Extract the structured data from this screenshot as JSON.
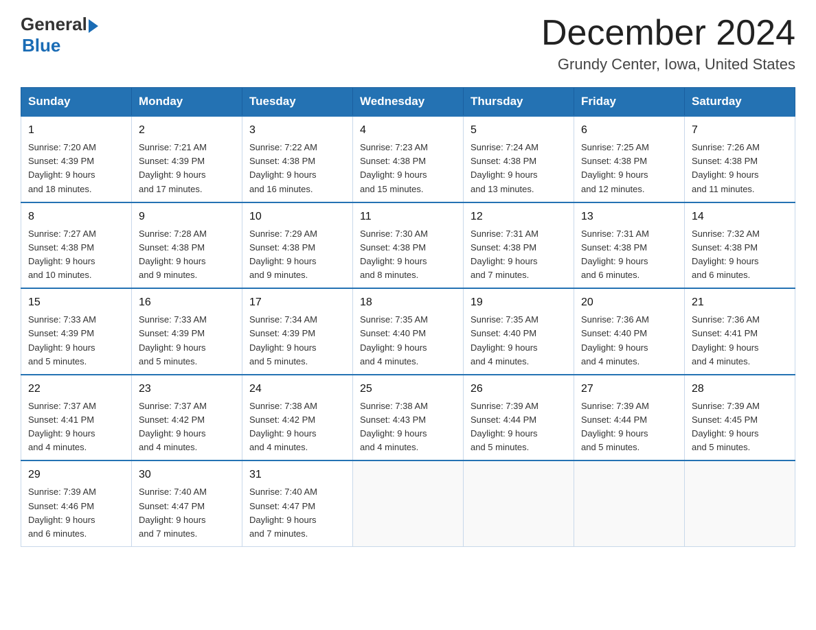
{
  "header": {
    "logo_general": "General",
    "logo_blue": "Blue",
    "month_title": "December 2024",
    "location": "Grundy Center, Iowa, United States"
  },
  "days_of_week": [
    "Sunday",
    "Monday",
    "Tuesday",
    "Wednesday",
    "Thursday",
    "Friday",
    "Saturday"
  ],
  "weeks": [
    [
      {
        "day": 1,
        "sunrise": "7:20 AM",
        "sunset": "4:39 PM",
        "daylight": "9 hours and 18 minutes."
      },
      {
        "day": 2,
        "sunrise": "7:21 AM",
        "sunset": "4:39 PM",
        "daylight": "9 hours and 17 minutes."
      },
      {
        "day": 3,
        "sunrise": "7:22 AM",
        "sunset": "4:38 PM",
        "daylight": "9 hours and 16 minutes."
      },
      {
        "day": 4,
        "sunrise": "7:23 AM",
        "sunset": "4:38 PM",
        "daylight": "9 hours and 15 minutes."
      },
      {
        "day": 5,
        "sunrise": "7:24 AM",
        "sunset": "4:38 PM",
        "daylight": "9 hours and 13 minutes."
      },
      {
        "day": 6,
        "sunrise": "7:25 AM",
        "sunset": "4:38 PM",
        "daylight": "9 hours and 12 minutes."
      },
      {
        "day": 7,
        "sunrise": "7:26 AM",
        "sunset": "4:38 PM",
        "daylight": "9 hours and 11 minutes."
      }
    ],
    [
      {
        "day": 8,
        "sunrise": "7:27 AM",
        "sunset": "4:38 PM",
        "daylight": "9 hours and 10 minutes."
      },
      {
        "day": 9,
        "sunrise": "7:28 AM",
        "sunset": "4:38 PM",
        "daylight": "9 hours and 9 minutes."
      },
      {
        "day": 10,
        "sunrise": "7:29 AM",
        "sunset": "4:38 PM",
        "daylight": "9 hours and 9 minutes."
      },
      {
        "day": 11,
        "sunrise": "7:30 AM",
        "sunset": "4:38 PM",
        "daylight": "9 hours and 8 minutes."
      },
      {
        "day": 12,
        "sunrise": "7:31 AM",
        "sunset": "4:38 PM",
        "daylight": "9 hours and 7 minutes."
      },
      {
        "day": 13,
        "sunrise": "7:31 AM",
        "sunset": "4:38 PM",
        "daylight": "9 hours and 6 minutes."
      },
      {
        "day": 14,
        "sunrise": "7:32 AM",
        "sunset": "4:38 PM",
        "daylight": "9 hours and 6 minutes."
      }
    ],
    [
      {
        "day": 15,
        "sunrise": "7:33 AM",
        "sunset": "4:39 PM",
        "daylight": "9 hours and 5 minutes."
      },
      {
        "day": 16,
        "sunrise": "7:33 AM",
        "sunset": "4:39 PM",
        "daylight": "9 hours and 5 minutes."
      },
      {
        "day": 17,
        "sunrise": "7:34 AM",
        "sunset": "4:39 PM",
        "daylight": "9 hours and 5 minutes."
      },
      {
        "day": 18,
        "sunrise": "7:35 AM",
        "sunset": "4:40 PM",
        "daylight": "9 hours and 4 minutes."
      },
      {
        "day": 19,
        "sunrise": "7:35 AM",
        "sunset": "4:40 PM",
        "daylight": "9 hours and 4 minutes."
      },
      {
        "day": 20,
        "sunrise": "7:36 AM",
        "sunset": "4:40 PM",
        "daylight": "9 hours and 4 minutes."
      },
      {
        "day": 21,
        "sunrise": "7:36 AM",
        "sunset": "4:41 PM",
        "daylight": "9 hours and 4 minutes."
      }
    ],
    [
      {
        "day": 22,
        "sunrise": "7:37 AM",
        "sunset": "4:41 PM",
        "daylight": "9 hours and 4 minutes."
      },
      {
        "day": 23,
        "sunrise": "7:37 AM",
        "sunset": "4:42 PM",
        "daylight": "9 hours and 4 minutes."
      },
      {
        "day": 24,
        "sunrise": "7:38 AM",
        "sunset": "4:42 PM",
        "daylight": "9 hours and 4 minutes."
      },
      {
        "day": 25,
        "sunrise": "7:38 AM",
        "sunset": "4:43 PM",
        "daylight": "9 hours and 4 minutes."
      },
      {
        "day": 26,
        "sunrise": "7:39 AM",
        "sunset": "4:44 PM",
        "daylight": "9 hours and 5 minutes."
      },
      {
        "day": 27,
        "sunrise": "7:39 AM",
        "sunset": "4:44 PM",
        "daylight": "9 hours and 5 minutes."
      },
      {
        "day": 28,
        "sunrise": "7:39 AM",
        "sunset": "4:45 PM",
        "daylight": "9 hours and 5 minutes."
      }
    ],
    [
      {
        "day": 29,
        "sunrise": "7:39 AM",
        "sunset": "4:46 PM",
        "daylight": "9 hours and 6 minutes."
      },
      {
        "day": 30,
        "sunrise": "7:40 AM",
        "sunset": "4:47 PM",
        "daylight": "9 hours and 7 minutes."
      },
      {
        "day": 31,
        "sunrise": "7:40 AM",
        "sunset": "4:47 PM",
        "daylight": "9 hours and 7 minutes."
      },
      null,
      null,
      null,
      null
    ]
  ],
  "labels": {
    "sunrise": "Sunrise:",
    "sunset": "Sunset:",
    "daylight": "Daylight:"
  }
}
